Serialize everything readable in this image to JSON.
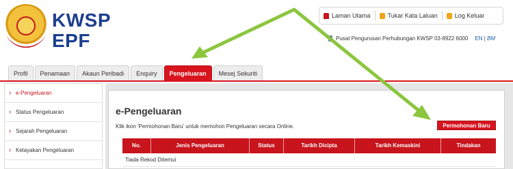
{
  "brand": {
    "line1": "KWSP",
    "line2": "EPF"
  },
  "top_nav": {
    "home": "Laman Utama",
    "change_password": "Tukar Kata Laluan",
    "logout": "Log Keluar"
  },
  "contact": {
    "text": "Pusat Pengurusan Perhubungan KWSP 03-8922 6000"
  },
  "lang": {
    "en": "EN",
    "sep": "|",
    "bm": "BM"
  },
  "tabs": [
    {
      "label": "Profil"
    },
    {
      "label": "Penamaan"
    },
    {
      "label": "Akaun Peribadi"
    },
    {
      "label": "Enquiry"
    },
    {
      "label": "Pengeluaran"
    },
    {
      "label": "Mesej Sekuriti"
    }
  ],
  "active_tab": "Pengeluaran",
  "sidebar": {
    "items": [
      {
        "label": "e-Pengeluaran"
      },
      {
        "label": "Status Pengeluaran"
      },
      {
        "label": "Sejarah Pengeluaran"
      },
      {
        "label": "Kelayakan Pengeluaran"
      }
    ]
  },
  "main": {
    "title": "e-Pengeluaran",
    "intro": "Klik ikon 'Permohonan Baru' untuk memohon Pengeluaran secara Online.",
    "new_button": "Permohonan Baru",
    "table": {
      "headers": [
        "No.",
        "Jenis Pengeluaran",
        "Status",
        "Tarikh Dicipta",
        "Tarikh Kemaskini",
        "Tindakan"
      ],
      "empty_text": "Tiada Rekod Ditemui"
    }
  },
  "colors": {
    "accent_red": "#d8141e",
    "brand_blue": "#1b3f8f",
    "annotation_green": "#8cc63f"
  },
  "icons": {
    "home": "home-icon",
    "lock": "lock-icon",
    "logout": "logout-icon",
    "phone": "phone-icon"
  }
}
